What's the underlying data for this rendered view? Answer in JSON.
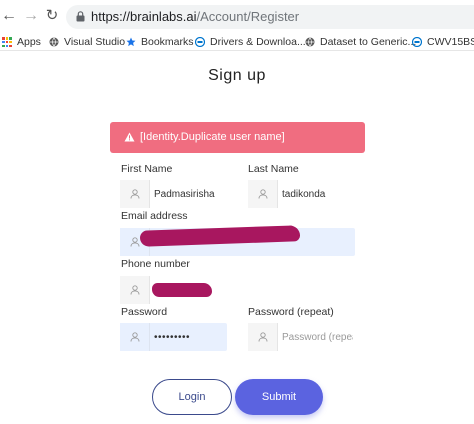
{
  "browser": {
    "url_host": "https://brainlabs.ai",
    "url_path": "/Account/Register",
    "bookmarks": [
      "Apps",
      "Visual Studio",
      "Bookmarks",
      "Drivers & Downloa...",
      "Dataset to Generic...",
      "CWV15BS"
    ]
  },
  "page": {
    "title": "Sign up",
    "alert": "[Identity.Duplicate user name]"
  },
  "form": {
    "first_name": {
      "label": "First Name",
      "value": "Padmasirisha"
    },
    "last_name": {
      "label": "Last Name",
      "value": "tadikonda"
    },
    "email": {
      "label": "Email address",
      "value": ""
    },
    "phone": {
      "label": "Phone number",
      "value": ""
    },
    "password": {
      "label": "Password",
      "value": "•••••••••"
    },
    "password_repeat": {
      "label": "Password (repeat)",
      "placeholder": "Password (repeat)"
    }
  },
  "buttons": {
    "login": "Login",
    "submit": "Submit"
  },
  "colors": {
    "alert_bg": "#f06d80",
    "submit_bg": "#5b63e0",
    "login_border": "#3b4a8c",
    "autofill_bg": "#e8f0fe",
    "redaction": "#a8175f"
  }
}
